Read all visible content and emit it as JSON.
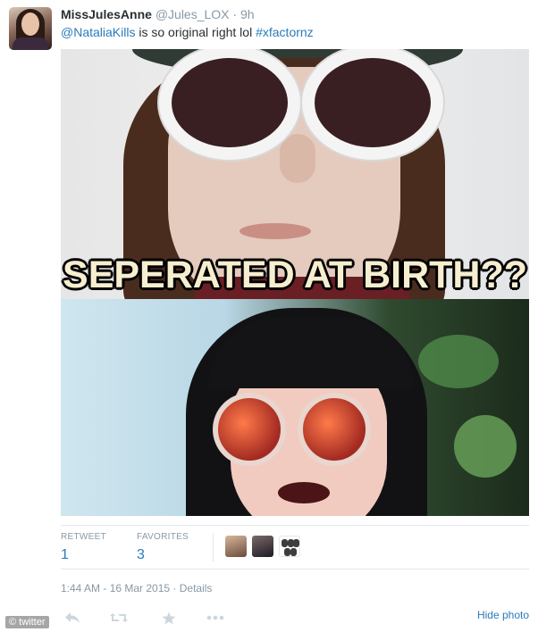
{
  "tweet": {
    "fullname": "MissJulesAnne",
    "handle": "@Jules_LOX",
    "separator": "·",
    "time": "9h",
    "mention": "@NataliaKills",
    "text_middle": " is so original right lol ",
    "hashtag": "#xfactornz"
  },
  "media": {
    "meme_caption": "SEPERATED AT BIRTH??"
  },
  "stats": {
    "retweet_label": "RETWEET",
    "retweet_count": "1",
    "favorites_label": "FAVORITES",
    "favorites_count": "3"
  },
  "timestamp": {
    "time": "1:44 AM - 16 Mar 2015",
    "separator": " · ",
    "details": "Details"
  },
  "actions": {
    "hide_photo": "Hide photo"
  },
  "watermark": "© twitter",
  "colors": {
    "link": "#2b7bb9",
    "muted": "#8899a6",
    "text": "#292f33",
    "border": "#e1e8ed"
  }
}
